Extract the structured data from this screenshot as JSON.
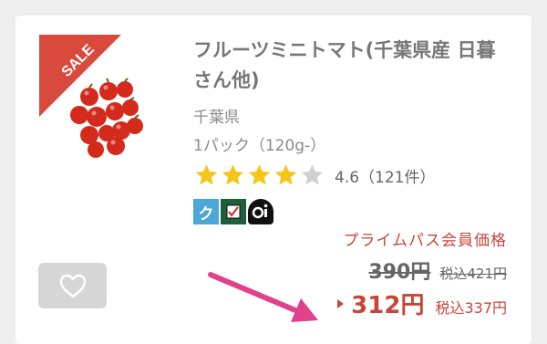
{
  "product": {
    "sale_badge": "SALE",
    "title": "フルーツミニトマト(千葉県産 日暮さん他)",
    "origin": "千葉県",
    "size": "1パック（120g-）",
    "rating_value": 4.6,
    "rating_text": "4.6（121件）",
    "stars_filled": 4,
    "stars_total": 5,
    "badges": [
      "ク",
      "check-icon",
      "oi-icon"
    ]
  },
  "pricing": {
    "prime_label": "プライムパス会員価格",
    "old_price": "390円",
    "old_tax": "税込421円",
    "price": "312円",
    "tax": "税込337円"
  },
  "colors": {
    "accent_red": "#c7463a",
    "star_gold": "#f5c518",
    "arrow_pink": "#e0418a"
  }
}
